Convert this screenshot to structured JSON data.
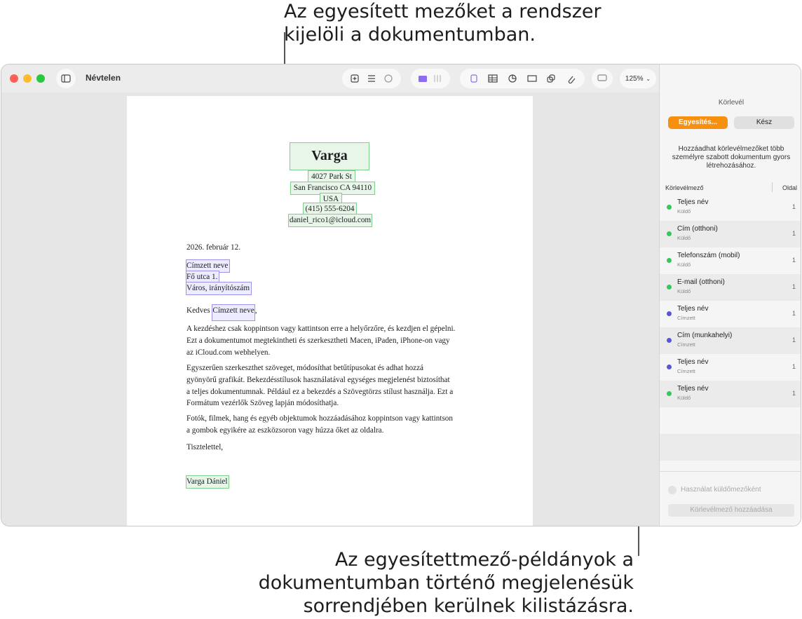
{
  "callouts": {
    "top": [
      "Az egyesített mezőket a rendszer",
      "kijelöli a dokumentumban."
    ],
    "bottom": [
      "Az egyesítettmező-példányok a",
      "dokumentumban történő megjelenésük",
      "sorrendjében kerülnek kilistázásra."
    ]
  },
  "window": {
    "title": "Névtelen",
    "zoom": "125%"
  },
  "toolbar_icons": [
    "sidebar-toggle-icon",
    "add-page-icon",
    "list-icon",
    "sparkle-icon",
    "media-icon",
    "grid-icon",
    "text-box-icon",
    "table-icon",
    "chart-icon",
    "text-icon",
    "shape-icon",
    "attachment-icon",
    "comment-icon",
    "share-icon",
    "format-brush-icon",
    "document-icon"
  ],
  "document": {
    "sender_name": "Varga Dániel",
    "sender_address": [
      "4027 Park St",
      "San Francisco CA 94110",
      "USA",
      "(415) 555-6204",
      "daniel_rico1@icloud.com"
    ],
    "date": "2026. február 12.",
    "recipient_address": [
      "Címzett neve",
      "Fő utca 1.",
      "Város, irányítószám"
    ],
    "salutation_prefix": "Kedves ",
    "salutation_field": "Címzett neve",
    "salutation_suffix": ",",
    "paragraphs": [
      [
        "A kezdéshez csak koppintson vagy kattintson erre a helyőrzőre, és kezdjen el gépelni.",
        "Ezt a dokumentumot megtekintheti és szerkesztheti Macen, iPaden, iPhone-on vagy",
        "az iCloud.com webhelyen."
      ],
      [
        "Egyszerűen szerkeszthet szöveget, módosíthat betűtípusokat és adhat hozzá",
        "gyönyörű grafikát. Bekezdésstílusok használatával egységes megjelenést biztosíthat",
        "a teljes dokumentumnak. Például ez a bekezdés a Szövegtörzs stílust használja. Ezt a",
        "Formátum vezérlők Szöveg lapján módosíthatja."
      ],
      [
        "Fotók, filmek, hang és egyéb objektumok hozzáadásához koppintson vagy kattintson",
        "a gombok egyikére az eszközsoron vagy húzza őket az oldalra."
      ]
    ],
    "closing": "Tisztelettel,",
    "signature": "Varga Dániel"
  },
  "sidebar": {
    "title": "Körlevél",
    "merge_button": "Egyesítés...",
    "done_button": "Kész",
    "description": "Hozzáadhat körlevélmezőket több személyre szabott dokumentum gyors létrehozásához.",
    "column_field": "Körlevélmező",
    "column_page": "Oldal",
    "fields": [
      {
        "name": "Teljes név",
        "type": "Küldő",
        "page": "1",
        "color": "#34c759"
      },
      {
        "name": "Cím (otthoni)",
        "type": "Küldő",
        "page": "1",
        "color": "#34c759"
      },
      {
        "name": "Telefonszám (mobil)",
        "type": "Küldő",
        "page": "1",
        "color": "#34c759"
      },
      {
        "name": "E-mail (otthoni)",
        "type": "Küldő",
        "page": "1",
        "color": "#34c759"
      },
      {
        "name": "Teljes név",
        "type": "Címzett",
        "page": "1",
        "color": "#5856d6"
      },
      {
        "name": "Cím (munkahelyi)",
        "type": "Címzett",
        "page": "1",
        "color": "#5856d6"
      },
      {
        "name": "Teljes név",
        "type": "Címzett",
        "page": "1",
        "color": "#5856d6"
      },
      {
        "name": "Teljes név",
        "type": "Küldő",
        "page": "1",
        "color": "#34c759"
      }
    ],
    "use_sender_fields": "Használat küldőmezőként",
    "add_field_button": "Körlevélmező hozzáadása"
  }
}
